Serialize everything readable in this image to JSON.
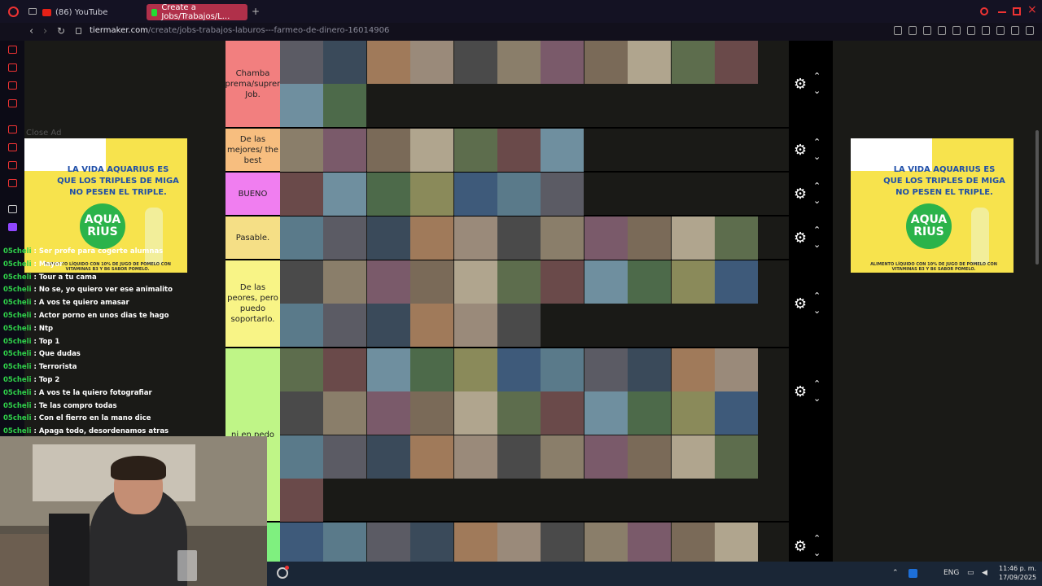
{
  "browser": {
    "tabs": [
      {
        "label": "(86) YouTube"
      },
      {
        "label": "Create a Jobs/Trabajos/L..."
      }
    ],
    "new_tab": "+",
    "url_host": "tiermaker.com",
    "url_path": "/create/jobs-trabajos-laburos---farmeo-de-dinero-16014906"
  },
  "ad": {
    "text": "LA VIDA AQUARIUS ES QUE LOS TRIPLES DE MIGA NO PESEN EL TRIPLE.",
    "logo": "AQUA RIUS",
    "fine_print": "ALIMENTO LÍQUIDO CON 10% DE JUGO DE POMELO CON VITAMINAS B3 Y B6 SABOR POMELO.",
    "close_label": "Close Ad",
    "accent": "#f7e34d"
  },
  "tiers": [
    {
      "label": "Chamba suprema/supreme Job.",
      "color": "#f27f7f",
      "thumbs": 13
    },
    {
      "label": "De las mejores/ the best",
      "color": "#f7be7f",
      "thumbs": 7
    },
    {
      "label": "BUENO",
      "color": "#f07ef0",
      "thumbs": 7
    },
    {
      "label": "Pasable.",
      "color": "#f5df86",
      "thumbs": 11
    },
    {
      "label": "De las peores, pero puedo soportarlo.",
      "color": "#f8f486",
      "thumbs": 17
    },
    {
      "label": "ni en pedo",
      "color": "#bff587",
      "thumbs": 34
    },
    {
      "label": "",
      "color": "#7ff07f",
      "thumbs": 11
    }
  ],
  "chat": [
    {
      "user": "05cheli",
      "text": "Ser profe para cogerte alumnas"
    },
    {
      "user": "05cheli",
      "text": "Mayor"
    },
    {
      "user": "05cheli",
      "text": "Tour a tu cama"
    },
    {
      "user": "05cheli",
      "text": "No se, yo quiero ver ese animalito"
    },
    {
      "user": "05cheli",
      "text": "A vos te quiero amasar"
    },
    {
      "user": "05cheli",
      "text": "Actor porno en unos dias te hago"
    },
    {
      "user": "05cheli",
      "text": "Ntp"
    },
    {
      "user": "05cheli",
      "text": "Top 1"
    },
    {
      "user": "05cheli",
      "text": "Que dudas"
    },
    {
      "user": "05cheli",
      "text": "Terrorista"
    },
    {
      "user": "05cheli",
      "text": "Top 2"
    },
    {
      "user": "05cheli",
      "text": "A vos te la quiero fotografiar"
    },
    {
      "user": "05cheli",
      "text": "Te las compro todas"
    },
    {
      "user": "05cheli",
      "text": "Con el fierro en la mano dice"
    },
    {
      "user": "05cheli",
      "text": "Apaga todo, desordenamos atras"
    }
  ],
  "taskbar": {
    "lang": "ENG",
    "time": "11:46 p. m.",
    "date": "17/09/2025"
  },
  "icons": {
    "gear": "⚙",
    "up": "⌃",
    "down": "⌄"
  }
}
